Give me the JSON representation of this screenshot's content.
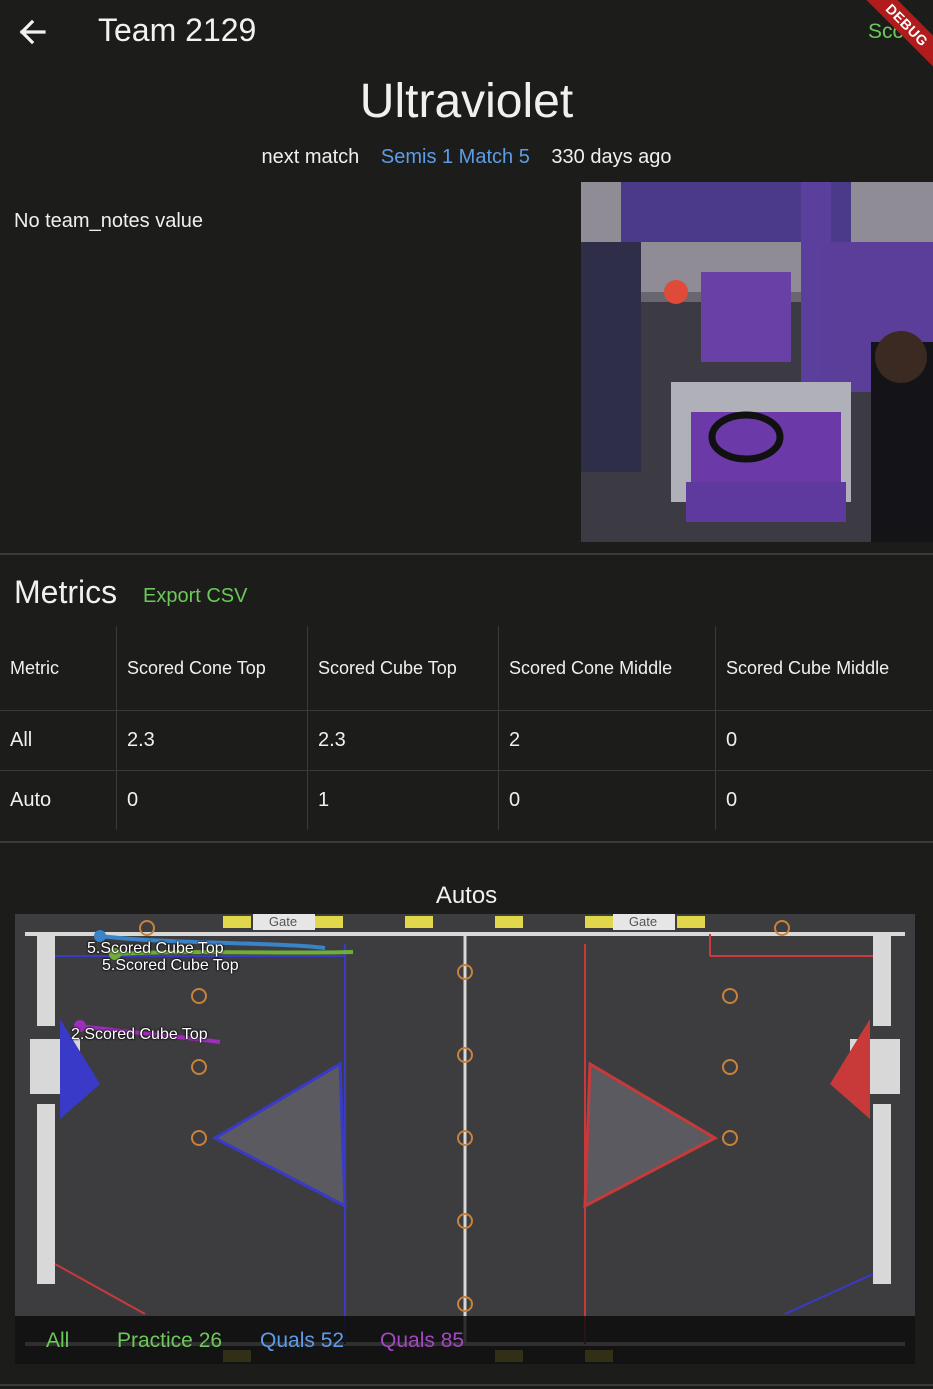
{
  "appbar": {
    "title": "Team 2129",
    "scout_label": "Scout",
    "debug_banner": "DEBUG"
  },
  "team": {
    "name": "Ultraviolet"
  },
  "next_match": {
    "label": "next match",
    "match": "Semis 1 Match 5",
    "time": "330 days ago"
  },
  "notes": "No team_notes value",
  "metrics": {
    "title": "Metrics",
    "export_label": "Export CSV",
    "columns": [
      "Metric",
      "Scored Cone Top",
      "Scored Cube Top",
      "Scored Cone Middle",
      "Scored Cube Middle"
    ],
    "rows": [
      [
        "All",
        "2.3",
        "2.3",
        "2",
        "0"
      ],
      [
        "Auto",
        "0",
        "1",
        "0",
        "0"
      ]
    ]
  },
  "autos": {
    "title": "Autos",
    "paths": [
      {
        "label": "5.Scored Cube Top",
        "color": "#3a83c9"
      },
      {
        "label": "5.Scored Cube Top",
        "color": "#6fae3a"
      },
      {
        "label": "2.Scored Cube Top",
        "color": "#9b2fb5"
      }
    ],
    "field_gate_label": "Gate",
    "filters": [
      {
        "label": "All",
        "color": "#6cc85a"
      },
      {
        "label": "Practice 26",
        "color": "#6cc85a"
      },
      {
        "label": "Quals 52",
        "color": "#5d9de8"
      },
      {
        "label": "Quals 85",
        "color": "#a447c2"
      }
    ]
  },
  "colors": {
    "background": "#1c1d1a",
    "accent_green": "#6cc85a",
    "link_blue": "#5d9de8"
  }
}
